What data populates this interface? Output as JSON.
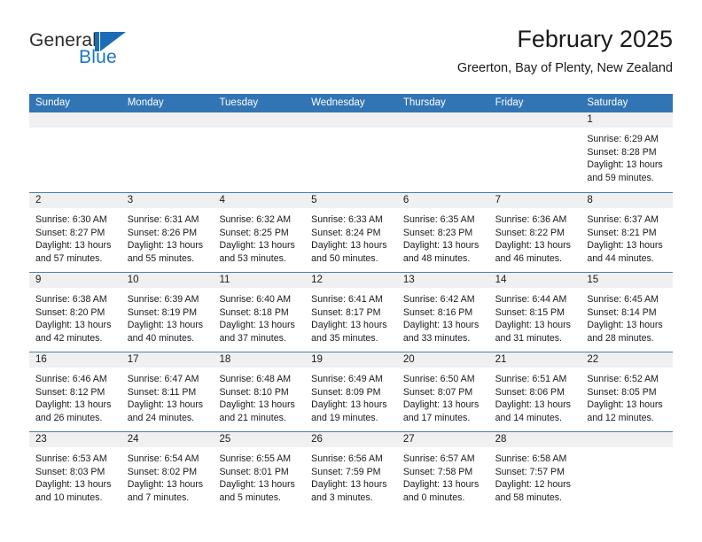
{
  "brand": {
    "name_top": "General",
    "name_bottom": "Blue",
    "logo_icon": "sail-triangle-logo",
    "accent_color": "#1B6CB5"
  },
  "header": {
    "title": "February 2025",
    "subtitle": "Greerton, Bay of Plenty, New Zealand"
  },
  "calendar": {
    "header_color": "#3275B5",
    "weekday_headers": [
      "Sunday",
      "Monday",
      "Tuesday",
      "Wednesday",
      "Thursday",
      "Friday",
      "Saturday"
    ],
    "weeks": [
      [
        {
          "day": "",
          "empty": true
        },
        {
          "day": "",
          "empty": true
        },
        {
          "day": "",
          "empty": true
        },
        {
          "day": "",
          "empty": true
        },
        {
          "day": "",
          "empty": true
        },
        {
          "day": "",
          "empty": true
        },
        {
          "day": "1",
          "sunrise": "Sunrise: 6:29 AM",
          "sunset": "Sunset: 8:28 PM",
          "daylight1": "Daylight: 13 hours",
          "daylight2": "and 59 minutes."
        }
      ],
      [
        {
          "day": "2",
          "sunrise": "Sunrise: 6:30 AM",
          "sunset": "Sunset: 8:27 PM",
          "daylight1": "Daylight: 13 hours",
          "daylight2": "and 57 minutes."
        },
        {
          "day": "3",
          "sunrise": "Sunrise: 6:31 AM",
          "sunset": "Sunset: 8:26 PM",
          "daylight1": "Daylight: 13 hours",
          "daylight2": "and 55 minutes."
        },
        {
          "day": "4",
          "sunrise": "Sunrise: 6:32 AM",
          "sunset": "Sunset: 8:25 PM",
          "daylight1": "Daylight: 13 hours",
          "daylight2": "and 53 minutes."
        },
        {
          "day": "5",
          "sunrise": "Sunrise: 6:33 AM",
          "sunset": "Sunset: 8:24 PM",
          "daylight1": "Daylight: 13 hours",
          "daylight2": "and 50 minutes."
        },
        {
          "day": "6",
          "sunrise": "Sunrise: 6:35 AM",
          "sunset": "Sunset: 8:23 PM",
          "daylight1": "Daylight: 13 hours",
          "daylight2": "and 48 minutes."
        },
        {
          "day": "7",
          "sunrise": "Sunrise: 6:36 AM",
          "sunset": "Sunset: 8:22 PM",
          "daylight1": "Daylight: 13 hours",
          "daylight2": "and 46 minutes."
        },
        {
          "day": "8",
          "sunrise": "Sunrise: 6:37 AM",
          "sunset": "Sunset: 8:21 PM",
          "daylight1": "Daylight: 13 hours",
          "daylight2": "and 44 minutes."
        }
      ],
      [
        {
          "day": "9",
          "sunrise": "Sunrise: 6:38 AM",
          "sunset": "Sunset: 8:20 PM",
          "daylight1": "Daylight: 13 hours",
          "daylight2": "and 42 minutes."
        },
        {
          "day": "10",
          "sunrise": "Sunrise: 6:39 AM",
          "sunset": "Sunset: 8:19 PM",
          "daylight1": "Daylight: 13 hours",
          "daylight2": "and 40 minutes."
        },
        {
          "day": "11",
          "sunrise": "Sunrise: 6:40 AM",
          "sunset": "Sunset: 8:18 PM",
          "daylight1": "Daylight: 13 hours",
          "daylight2": "and 37 minutes."
        },
        {
          "day": "12",
          "sunrise": "Sunrise: 6:41 AM",
          "sunset": "Sunset: 8:17 PM",
          "daylight1": "Daylight: 13 hours",
          "daylight2": "and 35 minutes."
        },
        {
          "day": "13",
          "sunrise": "Sunrise: 6:42 AM",
          "sunset": "Sunset: 8:16 PM",
          "daylight1": "Daylight: 13 hours",
          "daylight2": "and 33 minutes."
        },
        {
          "day": "14",
          "sunrise": "Sunrise: 6:44 AM",
          "sunset": "Sunset: 8:15 PM",
          "daylight1": "Daylight: 13 hours",
          "daylight2": "and 31 minutes."
        },
        {
          "day": "15",
          "sunrise": "Sunrise: 6:45 AM",
          "sunset": "Sunset: 8:14 PM",
          "daylight1": "Daylight: 13 hours",
          "daylight2": "and 28 minutes."
        }
      ],
      [
        {
          "day": "16",
          "sunrise": "Sunrise: 6:46 AM",
          "sunset": "Sunset: 8:12 PM",
          "daylight1": "Daylight: 13 hours",
          "daylight2": "and 26 minutes."
        },
        {
          "day": "17",
          "sunrise": "Sunrise: 6:47 AM",
          "sunset": "Sunset: 8:11 PM",
          "daylight1": "Daylight: 13 hours",
          "daylight2": "and 24 minutes."
        },
        {
          "day": "18",
          "sunrise": "Sunrise: 6:48 AM",
          "sunset": "Sunset: 8:10 PM",
          "daylight1": "Daylight: 13 hours",
          "daylight2": "and 21 minutes."
        },
        {
          "day": "19",
          "sunrise": "Sunrise: 6:49 AM",
          "sunset": "Sunset: 8:09 PM",
          "daylight1": "Daylight: 13 hours",
          "daylight2": "and 19 minutes."
        },
        {
          "day": "20",
          "sunrise": "Sunrise: 6:50 AM",
          "sunset": "Sunset: 8:07 PM",
          "daylight1": "Daylight: 13 hours",
          "daylight2": "and 17 minutes."
        },
        {
          "day": "21",
          "sunrise": "Sunrise: 6:51 AM",
          "sunset": "Sunset: 8:06 PM",
          "daylight1": "Daylight: 13 hours",
          "daylight2": "and 14 minutes."
        },
        {
          "day": "22",
          "sunrise": "Sunrise: 6:52 AM",
          "sunset": "Sunset: 8:05 PM",
          "daylight1": "Daylight: 13 hours",
          "daylight2": "and 12 minutes."
        }
      ],
      [
        {
          "day": "23",
          "sunrise": "Sunrise: 6:53 AM",
          "sunset": "Sunset: 8:03 PM",
          "daylight1": "Daylight: 13 hours",
          "daylight2": "and 10 minutes."
        },
        {
          "day": "24",
          "sunrise": "Sunrise: 6:54 AM",
          "sunset": "Sunset: 8:02 PM",
          "daylight1": "Daylight: 13 hours",
          "daylight2": "and 7 minutes."
        },
        {
          "day": "25",
          "sunrise": "Sunrise: 6:55 AM",
          "sunset": "Sunset: 8:01 PM",
          "daylight1": "Daylight: 13 hours",
          "daylight2": "and 5 minutes."
        },
        {
          "day": "26",
          "sunrise": "Sunrise: 6:56 AM",
          "sunset": "Sunset: 7:59 PM",
          "daylight1": "Daylight: 13 hours",
          "daylight2": "and 3 minutes."
        },
        {
          "day": "27",
          "sunrise": "Sunrise: 6:57 AM",
          "sunset": "Sunset: 7:58 PM",
          "daylight1": "Daylight: 13 hours",
          "daylight2": "and 0 minutes."
        },
        {
          "day": "28",
          "sunrise": "Sunrise: 6:58 AM",
          "sunset": "Sunset: 7:57 PM",
          "daylight1": "Daylight: 12 hours",
          "daylight2": "and 58 minutes."
        },
        {
          "day": "",
          "empty": true
        }
      ]
    ]
  }
}
